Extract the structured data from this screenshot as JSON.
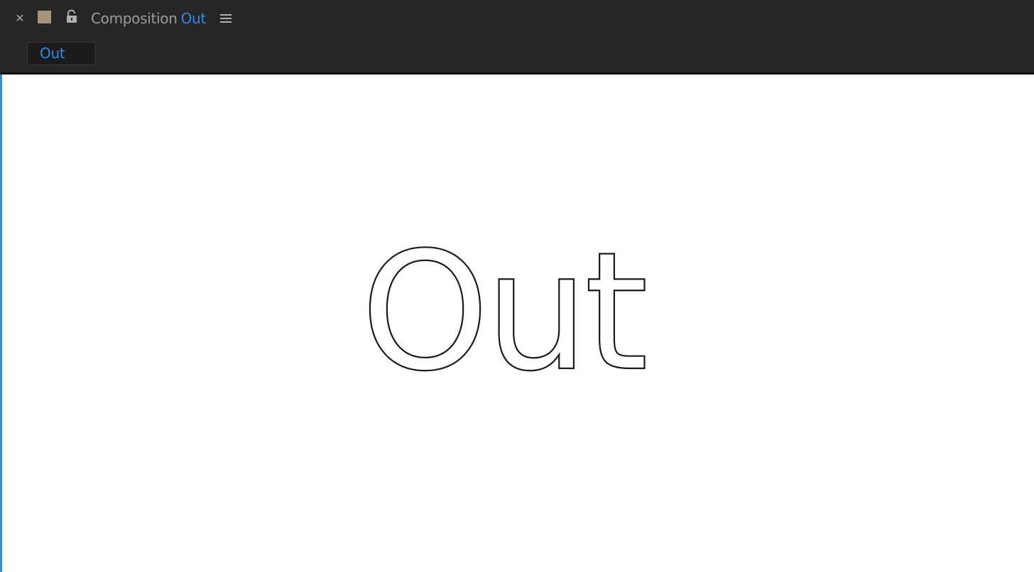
{
  "panel": {
    "label": "Composition",
    "comp_name": "Out"
  },
  "tabs": [
    {
      "label": "Out",
      "active": true
    }
  ],
  "canvas": {
    "text_layer": "Out",
    "background_color": "#ffffff",
    "stroke_color": "#1a1a1a"
  },
  "colors": {
    "accent": "#2d8ceb",
    "label_swatch": "#a89479",
    "panel_bg": "#262626"
  },
  "icons": {
    "close": "close-icon",
    "lock": "lock-open-icon",
    "menu": "hamburger-menu-icon"
  }
}
